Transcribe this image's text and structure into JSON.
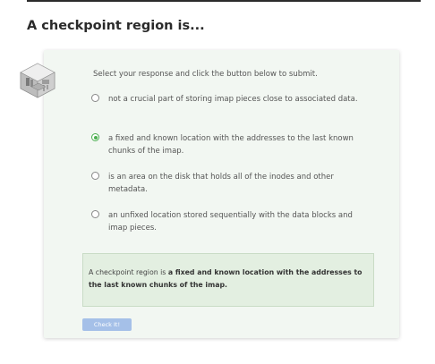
{
  "question": {
    "title": "A checkpoint region is..."
  },
  "card": {
    "instructions": "Select your response and click the button below to submit.",
    "options": [
      {
        "label": "not a crucial part of storing imap pieces close to associated data.",
        "selected": false
      },
      {
        "label": "a fixed and known location with the addresses to the last known chunks of the imap.",
        "selected": true
      },
      {
        "label": "is an area on the disk that holds all of the inodes and other metadata.",
        "selected": false
      },
      {
        "label": "an unfixed location stored sequentially with the data blocks and imap pieces.",
        "selected": false
      }
    ],
    "feedback": {
      "prefix": "A checkpoint region is ",
      "answer": "a fixed and known location with the addresses to the last known chunks of the imap."
    },
    "submit_label": "Check It!"
  },
  "icons": {
    "avatar": "isometric-room-icon",
    "radio_selected": "radio-checked-icon",
    "radio_unselected": "radio-unchecked-icon"
  },
  "colors": {
    "card_bg": "#f2f7f2",
    "feedback_bg": "#e3efe1",
    "accent_green": "#4caf50",
    "button_bg": "#a5c0e8"
  }
}
